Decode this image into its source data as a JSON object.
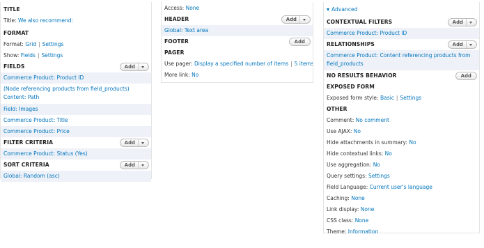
{
  "col1": {
    "title_head": "TITLE",
    "title_label": "Title:",
    "title_value": "We also recommend:",
    "format_head": "FORMAT",
    "format_label": "Format:",
    "format_value": "Grid",
    "format_settings": "Settings",
    "show_label": "Show:",
    "show_value": "Fields",
    "show_settings": "Settings",
    "fields_head": "FIELDS",
    "fields": [
      "Commerce Product: Product ID",
      "(Node referencing products from field_products) Content: Path",
      "Field: Images",
      "Commerce Product: Title",
      "Commerce Product: Price"
    ],
    "filter_head": "FILTER CRITERIA",
    "filters": [
      "Commerce Product: Status (Yes)"
    ],
    "sort_head": "SORT CRITERIA",
    "sorts": [
      "Global: Random (asc)"
    ],
    "add_label": "Add"
  },
  "col2": {
    "access_label": "Access:",
    "access_value": "None",
    "header_head": "HEADER",
    "header_item": "Global: Text area",
    "footer_head": "FOOTER",
    "pager_head": "PAGER",
    "pager_label": "Use pager:",
    "pager_value": "Display a specified number of items",
    "pager_items": "5 items",
    "more_label": "More link:",
    "more_value": "No",
    "add_label": "Add"
  },
  "col3": {
    "advanced": "Advanced",
    "contextual_head": "CONTEXTUAL FILTERS",
    "contextual_item": "Commerce Product: Product ID",
    "relationships_head": "RELATIONSHIPS",
    "relationship_item": "Commerce Product: Content referencing products from field_products",
    "no_results_head": "NO RESULTS BEHAVIOR",
    "exposed_head": "EXPOSED FORM",
    "exposed_label": "Exposed form style:",
    "exposed_value": "Basic",
    "exposed_settings": "Settings",
    "other_head": "OTHER",
    "other": [
      {
        "label": "Comment:",
        "value": "No comment"
      },
      {
        "label": "Use AJAX:",
        "value": "No"
      },
      {
        "label": "Hide attachments in summary:",
        "value": "No"
      },
      {
        "label": "Hide contextual links:",
        "value": "No"
      },
      {
        "label": "Use aggregation:",
        "value": "No"
      },
      {
        "label": "Query settings:",
        "value": "Settings"
      },
      {
        "label": "Field Language:",
        "value": "Current user's language"
      },
      {
        "label": "Caching:",
        "value": "None"
      },
      {
        "label": "Link display:",
        "value": "None"
      },
      {
        "label": "CSS class:",
        "value": "None"
      },
      {
        "label": "Theme:",
        "value": "Information"
      }
    ],
    "add_label": "Add"
  },
  "colors": {
    "link": "#0074bd",
    "row_shade": "#eef2f8",
    "border": "#e4e4e4"
  }
}
